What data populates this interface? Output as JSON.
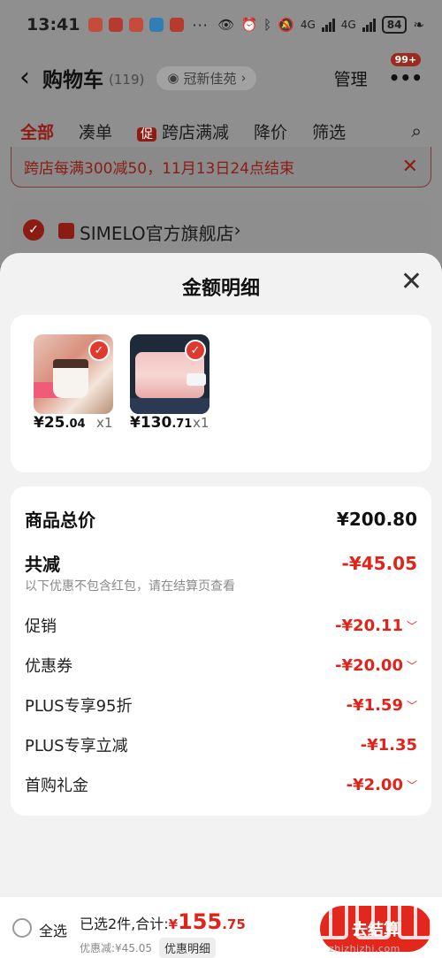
{
  "status_bar": {
    "time": "13:41",
    "more": "···",
    "network": "4G",
    "battery": "84"
  },
  "cart_header": {
    "title": "购物车",
    "count": "(119)",
    "location": "冠新佳苑",
    "manage_label": "管理",
    "more_badge": "99+"
  },
  "tabs": [
    {
      "label": "全部",
      "active": true
    },
    {
      "label": "凑单"
    },
    {
      "label": "跨店满减",
      "promo_mark": "促"
    },
    {
      "label": "降价"
    },
    {
      "label": "筛选"
    }
  ],
  "promo_banner": {
    "text": "跨店每满300减50，11月13日24点结束"
  },
  "store": {
    "name": "SIMELO官方旗舰店"
  },
  "sheet": {
    "title": "金额明细",
    "products": [
      {
        "price_int": "¥25",
        "price_dec": ".04",
        "qty": "x1"
      },
      {
        "price_int": "¥130",
        "price_dec": ".71",
        "qty": "x1"
      }
    ],
    "details": {
      "subtotal_label": "商品总价",
      "subtotal_value": "¥200.80",
      "total_discount_label": "共减",
      "total_discount_value": "-¥45.05",
      "note": "以下优惠不包含红包，请在结算页查看",
      "rows": [
        {
          "label": "促销",
          "value": "-¥20.11",
          "expandable": true
        },
        {
          "label": "优惠券",
          "value": "-¥20.00",
          "expandable": true
        },
        {
          "label": "PLUS专享95折",
          "value": "-¥1.59",
          "expandable": true
        },
        {
          "label": "PLUS专享立减",
          "value": "-¥1.35",
          "expandable": false
        },
        {
          "label": "首购礼金",
          "value": "-¥2.00",
          "expandable": true
        }
      ]
    }
  },
  "bottom_bar": {
    "select_all": "全选",
    "selected_text": "已选2件,合计:",
    "total_cur": "¥",
    "total_int": "155",
    "total_dec": ".75",
    "discount_text": "优惠减:¥45.05",
    "detail_chip": "优惠明细",
    "checkout_label": "去结算"
  },
  "watermark": "zhizhizhi.com",
  "colors": {
    "accent_red": "#e2231a",
    "overlay_gray": "#8f8f8f",
    "sheet_bg": "#f2f2f2"
  }
}
